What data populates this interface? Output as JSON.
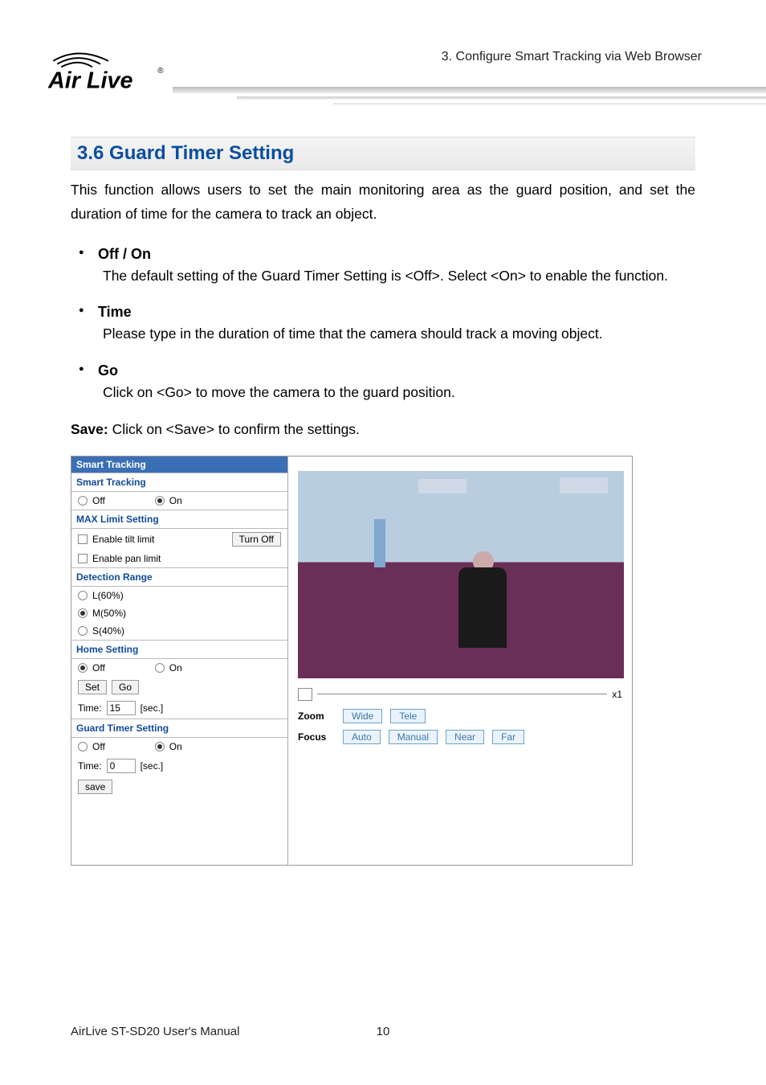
{
  "header": {
    "breadcrumb": "3. Configure Smart Tracking via Web Browser",
    "logo_text": "Air Live",
    "logo_r": "®"
  },
  "section": {
    "heading": "3.6 Guard Timer Setting",
    "intro": "This function allows users to set the main monitoring area as the guard position, and set the duration of time for the camera to track an object."
  },
  "bullets": {
    "off_on": {
      "head": "Off / On",
      "body": "The default setting of the Guard Timer Setting is <Off>. Select <On> to enable the function."
    },
    "time": {
      "head": "Time",
      "body": "Please type in the duration of time that the camera should track a moving object."
    },
    "go": {
      "head": "Go",
      "body": "Click on <Go> to move the camera to the guard position."
    }
  },
  "save_label": "Save:",
  "save_text": " Click on <Save> to confirm the settings.",
  "ui": {
    "title": "Smart Tracking",
    "smart_tracking": {
      "label": "Smart Tracking",
      "off": "Off",
      "on": "On",
      "selected": "on"
    },
    "max_limit": {
      "label": "MAX Limit Setting",
      "tilt": "Enable tilt limit",
      "turn_off": "Turn Off",
      "pan": "Enable pan limit"
    },
    "detection": {
      "label": "Detection Range",
      "l": "L(60%)",
      "m": "M(50%)",
      "s": "S(40%)",
      "selected": "m"
    },
    "home": {
      "label": "Home Setting",
      "off": "Off",
      "on": "On",
      "selected": "off",
      "set": "Set",
      "go": "Go",
      "time_label": "Time:",
      "time_val": "15",
      "sec": "[sec.]"
    },
    "guard": {
      "label": "Guard Timer Setting",
      "off": "Off",
      "on": "On",
      "selected": "on",
      "time_label": "Time:",
      "time_val": "0",
      "sec": "[sec.]",
      "save": "save"
    },
    "slider": {
      "zoom_mag": "x1"
    },
    "controls": {
      "zoom": "Zoom",
      "wide": "Wide",
      "tele": "Tele",
      "focus": "Focus",
      "auto": "Auto",
      "manual": "Manual",
      "near": "Near",
      "far": "Far"
    }
  },
  "footer": {
    "left": "AirLive ST-SD20 User's Manual",
    "page": "10"
  }
}
